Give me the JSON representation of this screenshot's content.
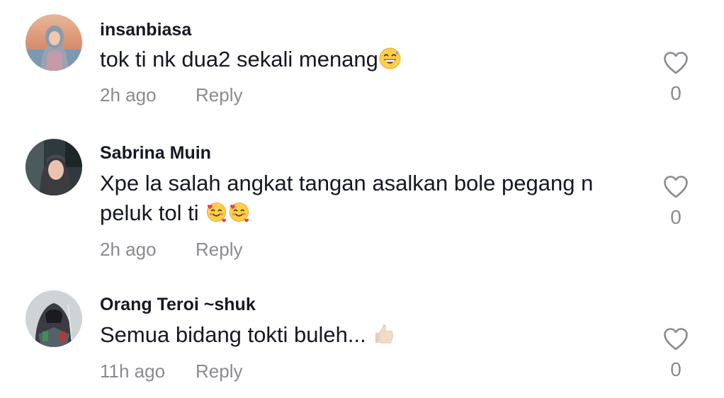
{
  "comments": [
    {
      "username": "insanbiasa",
      "text": "tok ti nk dua2 sekali menang",
      "emoji": "grinning-sweat-emoji",
      "time": "2h ago",
      "reply": "Reply",
      "likes": "0"
    },
    {
      "username": "Sabrina Muin",
      "text_line1": "Xpe la salah angkat tangan asalkan bole pegang n",
      "text_line2": "peluk tol ti ",
      "emoji": "smiling-face-with-hearts-emoji",
      "time": "2h ago",
      "reply": "Reply",
      "likes": "0"
    },
    {
      "username": "Orang Teroi ~shuk",
      "text": "Semua bidang tokti buleh... ",
      "emoji": "thumbs-up-emoji",
      "time": "11h ago",
      "reply": "Reply",
      "likes": "0"
    }
  ],
  "icons": {
    "like": "heart-outline-icon"
  },
  "colors": {
    "text": "#161823",
    "secondary": "#8a8b91",
    "background": "#ffffff"
  }
}
